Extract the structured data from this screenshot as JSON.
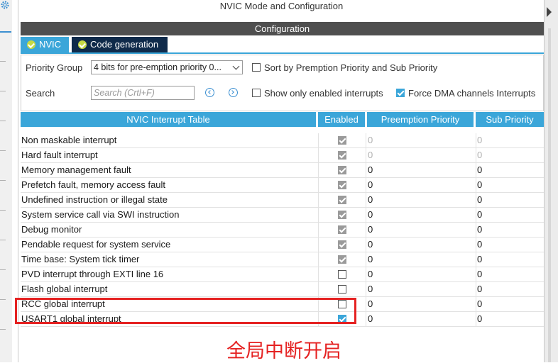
{
  "window_title": "NVIC Mode and Configuration",
  "config_header": "Configuration",
  "tabs": [
    {
      "label": "NVIC",
      "active": true
    },
    {
      "label": "Code generation",
      "active": false
    }
  ],
  "options": {
    "priority_group_label": "Priority Group",
    "priority_group_value": "4 bits for pre-emption priority 0...",
    "sort_label": "Sort by Premption Priority and Sub Priority",
    "sort_checked": false,
    "search_label": "Search",
    "search_placeholder": "Search (Crtl+F)",
    "show_enabled_label": "Show only enabled interrupts",
    "show_enabled_checked": false,
    "force_dma_label": "Force DMA channels Interrupts",
    "force_dma_checked": true
  },
  "table": {
    "headers": [
      "NVIC Interrupt Table",
      "Enabled",
      "Preemption Priority",
      "Sub Priority"
    ],
    "rows": [
      {
        "name": "Non maskable interrupt",
        "enabled": true,
        "locked": true,
        "preemption": "0",
        "sub": "0",
        "dim": true
      },
      {
        "name": "Hard fault interrupt",
        "enabled": true,
        "locked": true,
        "preemption": "0",
        "sub": "0",
        "dim": true
      },
      {
        "name": "Memory management fault",
        "enabled": true,
        "locked": true,
        "preemption": "0",
        "sub": "0",
        "dim": false
      },
      {
        "name": "Prefetch fault, memory access fault",
        "enabled": true,
        "locked": true,
        "preemption": "0",
        "sub": "0",
        "dim": false
      },
      {
        "name": "Undefined instruction or illegal state",
        "enabled": true,
        "locked": true,
        "preemption": "0",
        "sub": "0",
        "dim": false
      },
      {
        "name": "System service call via SWI instruction",
        "enabled": true,
        "locked": true,
        "preemption": "0",
        "sub": "0",
        "dim": false
      },
      {
        "name": "Debug monitor",
        "enabled": true,
        "locked": true,
        "preemption": "0",
        "sub": "0",
        "dim": false
      },
      {
        "name": "Pendable request for system service",
        "enabled": true,
        "locked": true,
        "preemption": "0",
        "sub": "0",
        "dim": false
      },
      {
        "name": "Time base: System tick timer",
        "enabled": true,
        "locked": true,
        "preemption": "0",
        "sub": "0",
        "dim": false
      },
      {
        "name": "PVD interrupt through EXTI line 16",
        "enabled": false,
        "locked": false,
        "preemption": "0",
        "sub": "0",
        "dim": false
      },
      {
        "name": "Flash global interrupt",
        "enabled": false,
        "locked": false,
        "preemption": "0",
        "sub": "0",
        "dim": false
      },
      {
        "name": "RCC global interrupt",
        "enabled": false,
        "locked": false,
        "preemption": "0",
        "sub": "0",
        "dim": false
      },
      {
        "name": "USART1 global interrupt",
        "enabled": true,
        "locked": false,
        "preemption": "0",
        "sub": "0",
        "dim": false
      }
    ]
  },
  "annotation_text": "全局中断开启",
  "colors": {
    "tab_active": "#3ba6d9",
    "tab_inactive": "#0f2a4a",
    "header_bar": "#4f4f4f",
    "annotation": "#e52222"
  }
}
